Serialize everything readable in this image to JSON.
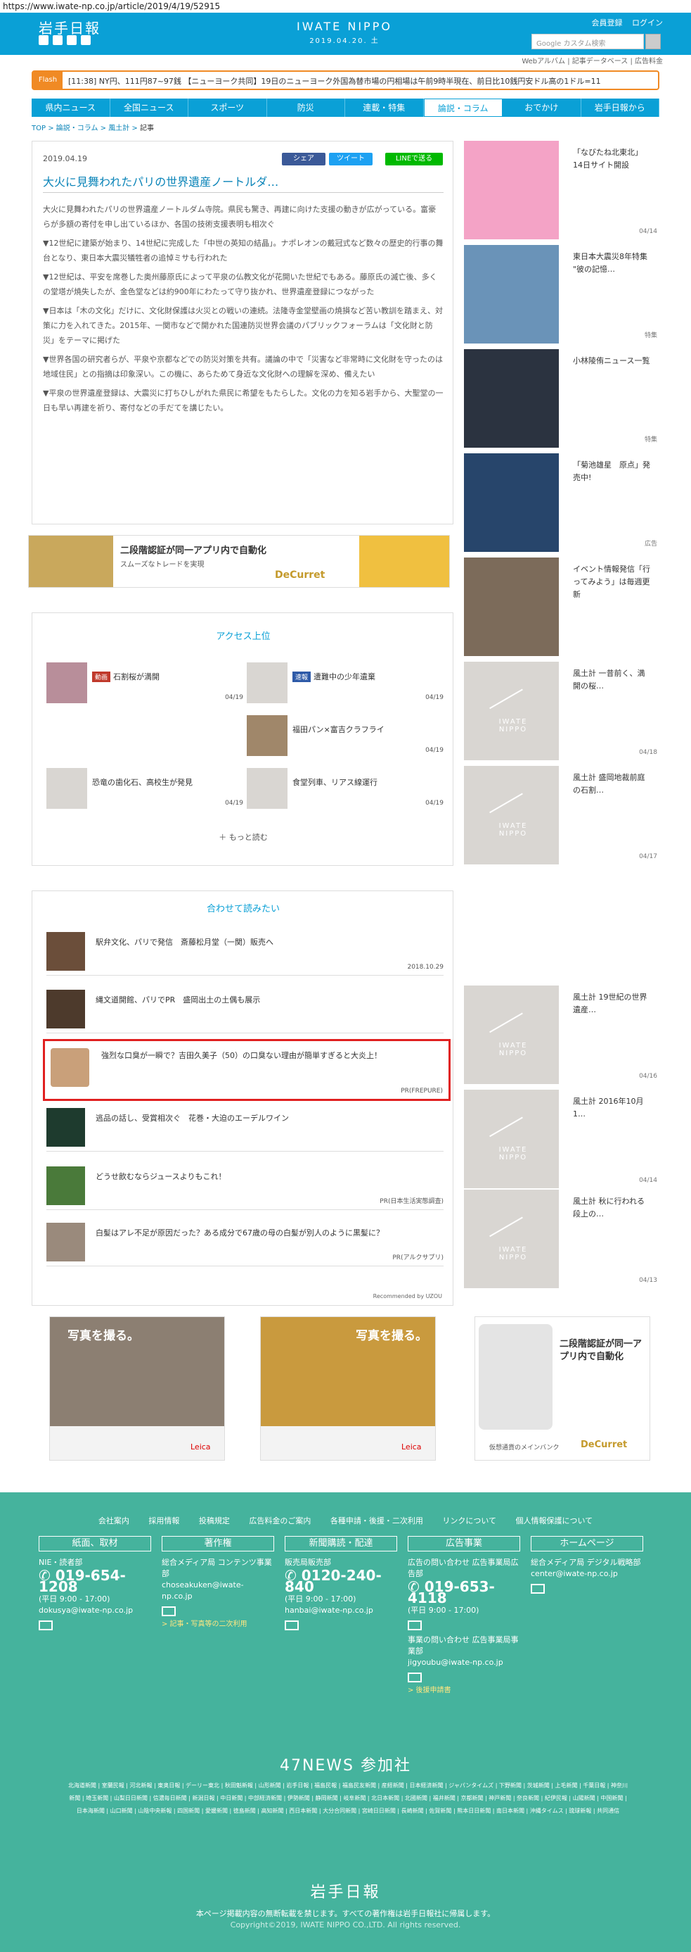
{
  "url": "https://www.iwate-np.co.jp/article/2019/4/19/52915",
  "header": {
    "logo": "岩手日報",
    "site_name": "IWATE NIPPO",
    "date": "2019.04.20. 土",
    "register": "会員登録",
    "login": "ログイン",
    "search_placeholder": "Google カスタム検索",
    "sub_links": [
      "Webアルバム",
      "記事データベース",
      "広告料金"
    ]
  },
  "flash": {
    "tag": "Flash",
    "text": "[11:38] NY円、111円87~97銭 【ニューヨーク共同】19日のニューヨーク外国為替市場の円相場は午前9時半現在、前日比10銭円安ドル高の1ドル=11"
  },
  "nav": [
    "県内ニュース",
    "全国ニュース",
    "スポーツ",
    "防災",
    "連載・特集",
    "論説・コラム",
    "おでかけ",
    "岩手日報から"
  ],
  "breadcrumb": [
    "TOP",
    "論説・コラム",
    "風土計",
    "記事"
  ],
  "article": {
    "date": "2019.04.19",
    "share_fb": "シェア",
    "share_tw": "ツイート",
    "share_line": "LINEで送る",
    "title": "大火に見舞われたパリの世界遺産ノートルダ…",
    "paragraphs": [
      "大火に見舞われたパリの世界遺産ノートルダム寺院。県民も驚き、再建に向けた支援の動きが広がっている。富豪らが多額の寄付を申し出ているほか、各国の技術支援表明も相次ぐ",
      "▼12世紀に建築が始まり、14世紀に完成した「中世の英知の結晶」。ナポレオンの戴冠式など数々の歴史的行事の舞台となり、東日本大震災犠牲者の追悼ミサも行われた",
      "▼12世紀は、平安を席巻した奥州藤原氏によって平泉の仏教文化が花開いた世紀でもある。藤原氏の滅亡後、多くの堂塔が焼失したが、金色堂などは約900年にわたって守り抜かれ、世界遺産登録につながった",
      "▼日本は「木の文化」だけに、文化財保護は火災との戦いの連続。法隆寺金堂壁画の焼損など苦い教訓を踏まえ、対策に力を入れてきた。2015年、一関市などで開かれた国連防災世界会議のパブリックフォーラムは「文化財と防災」をテーマに掲げた",
      "▼世界各国の研究者らが、平泉や京都などでの防災対策を共有。議論の中で「災害など非常時に文化財を守ったのは地域住民」との指摘は印象深い。この機に、あらためて身近な文化財への理解を深め、備えたい",
      "▼平泉の世界遺産登録は、大震災に打ちひしがれた県民に希望をもたらした。文化の力を知る岩手から、大聖堂の一日も早い再建を祈り、寄付などの手だてを講じたい。"
    ]
  },
  "ads": {
    "banner_text": "二段階認証が同一アプリ内で自動化",
    "banner_sub": "スムーズなトレードを実現",
    "brand": "DeCurret",
    "photo_ad": "写真を撮る。",
    "photo_brand": "Leica",
    "square_text": "二段階認証が同一アプリ内で自動化",
    "square_sub": "仮想通貨のメインバンク"
  },
  "sidebar": [
    {
      "text": "「なびたね北東北」14日サイト開設",
      "date": "04/14",
      "color": "#f4a3c6"
    },
    {
      "text": "東日本大震災8年特集 \"彼の記憶…",
      "date": "特集",
      "color": "#6a93b8"
    },
    {
      "text": "小林陵侑ニュース一覧",
      "date": "特集",
      "color": "#2b3340"
    },
    {
      "text": "「菊池雄星　原点」発売中!",
      "date": "広告",
      "color": "#27456b"
    },
    {
      "text": "イベント情報発信「行ってみよう」は毎週更新",
      "date": "",
      "color": "#7c6b5a"
    },
    {
      "text": "風土計 一昔前く、満開の桜…",
      "date": "04/18",
      "color": ""
    },
    {
      "text": "風土計 盛岡地裁前庭の石割…",
      "date": "04/17",
      "color": ""
    },
    {
      "text": "風土計 19世紀の世界遺産…",
      "date": "04/16",
      "color": ""
    },
    {
      "text": "風土計 2016年10月1…",
      "date": "04/14",
      "color": ""
    },
    {
      "text": "風土計 秋に行われる段上の…",
      "date": "04/13",
      "color": ""
    }
  ],
  "placeholder_logo": "IWATE NIPPO",
  "access": {
    "title": "アクセス上位",
    "items": [
      {
        "tag": "動画",
        "tag_color": "#c0392b",
        "text": "石割桜が満開",
        "date": "04/19"
      },
      {
        "tag": "速報",
        "tag_color": "#2e5aa8",
        "text": "遭難中の少年遺棄",
        "date": "04/19"
      },
      {
        "tag": "",
        "tag_color": "",
        "text": "",
        "date": ""
      },
      {
        "tag": "",
        "tag_color": "",
        "text": "福田パン×富吉クラフライ",
        "date": "04/19"
      },
      {
        "tag": "",
        "tag_color": "",
        "text": "恐竜の歯化石、高校生が発見",
        "date": "04/19"
      },
      {
        "tag": "",
        "tag_color": "",
        "text": "食堂列車、リアス線運行",
        "date": "04/19"
      }
    ],
    "more": "もっと読む"
  },
  "related": {
    "title": "合わせて読みたい",
    "items": [
      {
        "text": "駅弁文化、パリで発信　斎藤松月堂（一関）販売へ",
        "meta": "2018.10.29"
      },
      {
        "text": "縄文道開館、パリでPR　盛岡出土の土偶も展示",
        "meta": ""
      },
      {
        "text": "強烈な口臭が一瞬で？吉田久美子（50）の口臭ない理由が簡単すぎると大炎上！",
        "meta": "PR(FREPURE)"
      },
      {
        "text": "逃品の話し、受賞相次ぐ　花巻・大迫のエーデルワイン",
        "meta": ""
      },
      {
        "text": "どうせ飲むならジュースよりもこれ！",
        "meta": "PR(日本生活実態調査)"
      },
      {
        "text": "白髪はアレ不足が原因だった？ある成分で67歳の母の白髪が別人のように黒髪に？",
        "meta": "PR(アルクサプリ)"
      }
    ],
    "recommended": "Recommended by UZOU"
  },
  "footer": {
    "links": [
      "会社案内",
      "採用情報",
      "投稿規定",
      "広告料金のご案内",
      "各種申請・後援・二次利用",
      "リンクについて",
      "個人情報保護について"
    ],
    "cols": [
      {
        "head": "紙面、取材",
        "label": "NIE・読者部",
        "tel": "019-654-1208",
        "hours": "(平日 9:00 - 17:00)",
        "mail": "dokusya@iwate-np.co.jp",
        "link": ""
      },
      {
        "head": "著作権",
        "label": "総合メディア局 コンテンツ事業部",
        "tel": "",
        "hours": "",
        "mail": "choseakuken@iwate-np.co.jp",
        "link": "> 記事・写真等の二次利用"
      },
      {
        "head": "新聞購読・配達",
        "label": "販売局販売部",
        "tel": "0120-240-840",
        "hours": "(平日 9:00 - 17:00)",
        "mail": "hanbai@iwate-np.co.jp",
        "link": ""
      },
      {
        "head": "広告事業",
        "label": "広告の問い合わせ 広告事業局広告部",
        "tel": "019-653-4118",
        "hours": "(平日 9:00 - 17:00)",
        "mail": "jigyoubu@iwate-np.co.jp",
        "link": "> 後援申請書"
      },
      {
        "head": "ホームページ",
        "label": "総合メディア局 デジタル戦略部",
        "tel": "",
        "hours": "",
        "mail": "center@iwate-np.co.jp",
        "link": ""
      }
    ],
    "ad_extra": "事業の問い合わせ 広告事業局事業部",
    "news47": "47NEWS 参加社",
    "papers": "北海道新聞 | 室蘭民報 | 河北新報 | 東奥日報 | デーリー東北 | 秋田魁新報 | 山形新聞 | 岩手日報 | 福島民報 | 福島民友新聞 | 産経新聞 | 日本経済新聞 | ジャパンタイムズ | 下野新聞 | 茨城新聞 | 上毛新聞 | 千葉日報 | 神奈川新聞 | 埼玉新聞 | 山梨日日新聞 | 信濃毎日新聞 | 新潟日報 | 中日新聞 | 中部経済新聞 | 伊勢新聞 | 静岡新聞 | 岐阜新聞 | 北日本新聞 | 北國新聞 | 福井新聞 | 京都新聞 | 神戸新聞 | 奈良新聞 | 紀伊民報 | 山陽新聞 | 中国新聞 | 日本海新聞 | 山口新聞 | 山陰中央新報 | 四国新聞 | 愛媛新聞 | 徳島新聞 | 高知新聞 | 西日本新聞 | 大分合同新聞 | 宮崎日日新聞 | 長崎新聞 | 佐賀新聞 | 熊本日日新聞 | 南日本新聞 | 沖縄タイムス | 琉球新報 | 共同通信",
    "logo": "岩手日報",
    "note": "本ページ掲載内容の無断転載を禁じます。すべての著作権は岩手日報社に帰属します。",
    "copyright": "Copyright©2019, IWATE NIPPO CO.,LTD. All rights reserved."
  }
}
